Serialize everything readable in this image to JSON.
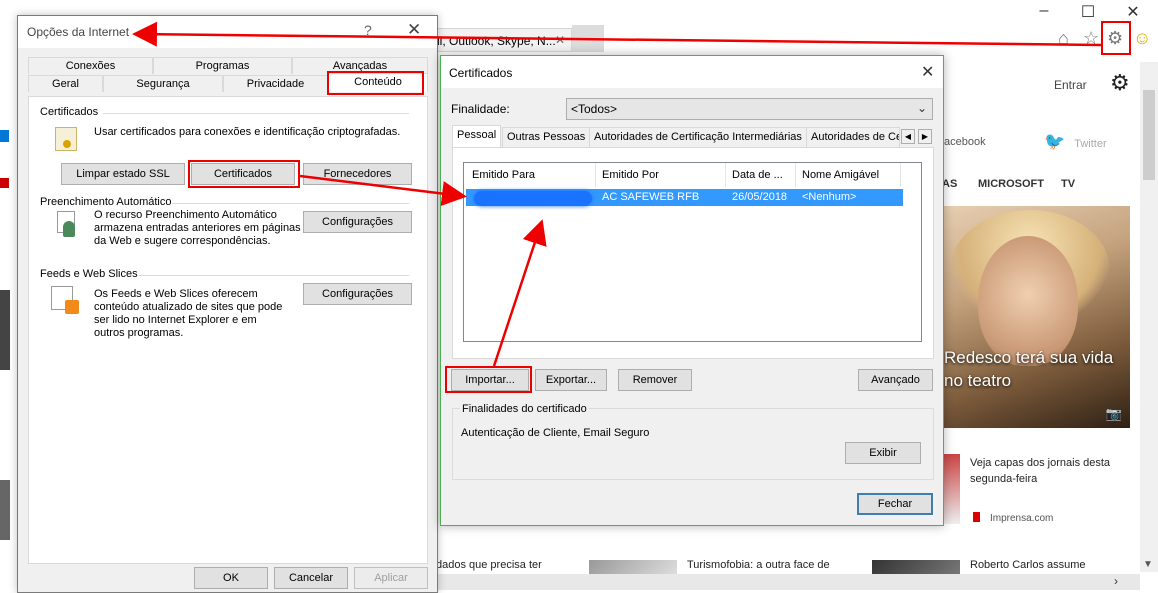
{
  "browser": {
    "tab_title": "il, Outlook, Skype, N...",
    "entrar": "Entrar",
    "social": [
      "acebook",
      "Twitter"
    ],
    "nav": [
      "AS",
      "MICROSOFT",
      "TV"
    ],
    "hero_caption": "Redesco terá sua vida no teatro",
    "news": [
      "Veja capas dos jornais desta segunda-feira",
      "Imprensa.com",
      "dados que precisa ter",
      "Turismofobia: a outra face de",
      "Roberto Carlos assume"
    ]
  },
  "internet_options": {
    "title": "Opções da Internet",
    "help": "?",
    "tabs_row1": [
      "Conexões",
      "Programas",
      "Avançadas"
    ],
    "tabs_row2": [
      "Geral",
      "Segurança",
      "Privacidade",
      "Conteúdo"
    ],
    "cert_section": "Certificados",
    "cert_desc": "Usar certificados para conexões e identificação criptografadas.",
    "btn_clear_ssl": "Limpar estado SSL",
    "btn_certificates": "Certificados",
    "btn_publishers": "Fornecedores",
    "autocomplete_section": "Preenchimento Automático",
    "autocomplete_desc": [
      "O recurso Preenchimento Automático",
      "armazena entradas anteriores em páginas",
      "da Web e sugere correspondências."
    ],
    "btn_settings": "Configurações",
    "feeds_section": "Feeds e Web Slices",
    "feeds_desc": [
      "Os Feeds e Web Slices oferecem",
      "conteúdo atualizado de sites que pode",
      "ser lido no Internet Explorer e em",
      "outros programas."
    ],
    "btn_ok": "OK",
    "btn_cancel": "Cancelar",
    "btn_apply": "Aplicar"
  },
  "certificates": {
    "title": "Certificados",
    "purpose_label": "Finalidade:",
    "purpose_value": "<Todos>",
    "tabs": [
      "Pessoal",
      "Outras Pessoas",
      "Autoridades de Certificação Intermediárias",
      "Autoridades de Ce"
    ],
    "columns": [
      "Emitido Para",
      "Emitido Por",
      "Data de ...",
      "Nome Amigável"
    ],
    "rows": [
      {
        "issued_by": "AC SAFEWEB RFB",
        "date": "26/05/2018",
        "friendly": "<Nenhum>"
      }
    ],
    "btn_import": "Importar...",
    "btn_export": "Exportar...",
    "btn_remove": "Remover",
    "btn_advanced": "Avançado",
    "purposes_group": "Finalidades do certificado",
    "purposes_value": "Autenticação de Cliente, Email Seguro",
    "btn_view": "Exibir",
    "btn_close": "Fechar"
  },
  "colors": {
    "annotation": "#e00000",
    "selection": "#3399ff",
    "accent": "#3c7fb1"
  }
}
